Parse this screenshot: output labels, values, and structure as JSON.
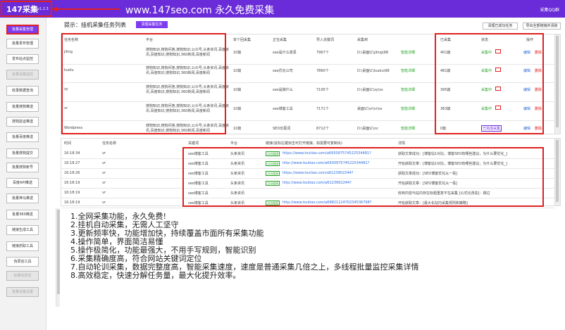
{
  "header": {
    "app_title": "147采集",
    "version": "v1.2.3",
    "promo": "www.147seo.com   永久免费采集",
    "qq_link": "采集QQ群"
  },
  "sidebar": {
    "items": [
      {
        "label": "批量采集管理",
        "state": "active"
      },
      {
        "label": "批量发布管理",
        "state": "normal"
      },
      {
        "label": "发布站点监控",
        "state": "normal"
      },
      {
        "label": "批量采集监控",
        "state": "disabled"
      },
      {
        "label": "收录数据查询",
        "state": "normal"
      },
      {
        "label": "批量搜狗推送",
        "state": "normal"
      },
      {
        "label": "搜狗验证推送",
        "state": "normal"
      },
      {
        "label": "批量百度推送",
        "state": "normal"
      },
      {
        "label": "批量搜狗提交",
        "state": "normal"
      },
      {
        "label": "批量搜狗帐号",
        "state": "normal"
      },
      {
        "label": "百度API推送",
        "state": "normal"
      },
      {
        "label": "批量神马推送",
        "state": "normal"
      },
      {
        "label": "批量360推送",
        "state": "normal"
      },
      {
        "label": "链接生成工具",
        "state": "normal"
      },
      {
        "label": "链接抓取工具",
        "state": "normal"
      },
      {
        "label": "伪原创工具",
        "state": "normal"
      },
      {
        "label": "批量伪原创",
        "state": "disabled"
      },
      {
        "label": "批量采集设置",
        "state": "disabled"
      }
    ]
  },
  "toolbar": {
    "tip": "提示：挂机采集任务列表",
    "clear_button": "清理采集任务",
    "import_button": "清理已成功任务",
    "export_button": "导出全部链接并清除"
  },
  "task_table": {
    "headers": [
      "任务名称",
      "平台",
      "单个回采集",
      "正在采集",
      "导入关键词",
      "采集到",
      "已采集",
      "状态",
      "操作"
    ],
    "rows": [
      {
        "name": "jiling",
        "platform": "搜狗知识,搜狗问答,搜狗知识,公众号,头条资讯,百度资讯,百度知识,搜狗知识,360新闻,百度新闻",
        "single": "10篇",
        "current": "seo是什么意思",
        "keywords": "7967个",
        "path": "D:\\桌面\\C\\jiling\\98",
        "status_link": "智能详细",
        "collected": "401篇",
        "state": "采集中",
        "edit": "编辑",
        "del": "删除"
      },
      {
        "name": "kuolu",
        "platform": "搜狗知识,搜狗问答,搜狗知识,公众号,头条资讯,百度资讯,百度知识,搜狗知识,360新闻,百度新闻",
        "single": "10篇",
        "current": "seo优化公司",
        "keywords": "7860个",
        "path": "D:\\桌面\\C\\kuolu\\98",
        "status_link": "智能详细",
        "collected": "481篇",
        "state": "采集中",
        "edit": "编辑",
        "del": "删除"
      },
      {
        "name": "zy",
        "platform": "搜狗知识,搜狗问答,搜狗知识,公众号,头条资讯,百度资讯,百度知识,搜狗知识,360新闻,百度新闻",
        "single": "10篇",
        "current": "seo是做什么",
        "keywords": "7195个",
        "path": "D:\\桌面\\C\\zy\\ss",
        "status_link": "智能详细",
        "collected": "395篇",
        "state": "采集中",
        "edit": "编辑",
        "del": "删除"
      },
      {
        "name": "vr",
        "platform": "搜狗知识,搜狗问答,搜狗知识,公众号,头条资讯,百度资讯,百度知识,搜狗知识,360新闻,百度新闻",
        "single": "10篇",
        "current": "seo博客工具",
        "keywords": "7171个",
        "path": "桌面\\C\\vr\\vr\\ss",
        "status_link": "智能详细",
        "collected": "363篇",
        "state": "采集中",
        "edit": "编辑",
        "del": "删除"
      },
      {
        "name": "Wordpress",
        "platform": "搜狗知识,搜狗问答,搜狗知识,公众号,头条资讯,百度资讯,百度知识,搜狗知识,360新闻,百度新闻",
        "single": "10篇",
        "current": "SEO长尾词",
        "keywords": "8712个",
        "path": "D:\\桌面\\C\\nc",
        "status_link": "智能详细",
        "collected": "0篇",
        "state": "已完成采集",
        "edit": "编辑",
        "del": "删除"
      }
    ]
  },
  "log_table": {
    "headers": [
      "时间",
      "任务名称",
      "关键词",
      "平台",
      "链接(鼠标左键双击可打开链接，如需要可复制出)",
      "详情"
    ],
    "rows": [
      {
        "time": "16:18:34",
        "task": "vr",
        "keyword": "seo博客工具",
        "platform": "头条资讯",
        "tag": "点击链接",
        "url": "https://www.toutiao.com/a693097574522534481?",
        "detail": "获取文章成功：[博客站1对比，博客SEO有哪些建议，为什么要优化_]"
      },
      {
        "time": "16:18:27",
        "task": "vr",
        "keyword": "seo博客工具",
        "platform": "头条资讯",
        "tag": "点击链接",
        "url": "http://www.toutiao.com/a693097574522534481?",
        "detail": "开始获取文章：[博客站1对比，博客SEO有哪些建议，为什么要优化_]"
      },
      {
        "time": "16:18:26",
        "task": "vr",
        "keyword": "seo博客工具",
        "platform": "头条资讯",
        "tag": "点击链接",
        "url": "https://www.toutiao.com/a6123902244?",
        "detail": "获取文章成功：[SEO博客优化从一看]"
      },
      {
        "time": "16:18:19",
        "task": "vr",
        "keyword": "seo博客工具",
        "platform": "头条资讯",
        "tag": "点击链接",
        "url": "http://www.toutiao.com/a6123902244?",
        "detail": "开始获取文章：[SEO博客优化从一看]"
      },
      {
        "time": "16:18:19",
        "task": "vr",
        "keyword": "seo博客工具",
        "platform": "头条资讯",
        "tag": "",
        "url": "",
        "detail": "收到内容与站内存在标题重复不在采集 [公式化改造]：跳过"
      },
      {
        "time": "16:18:19",
        "task": "vr",
        "keyword": "seo博客工具",
        "platform": "头条资讯",
        "tag": "点击链接",
        "url": "http://www.toutiao.com/a6982112470234536798?",
        "detail": "开始获取文章：[最大化站内采集规则和策略]"
      }
    ]
  },
  "features": [
    "1.全网采集功能，永久免费!",
    "2.挂机自动采集，无需人工坚守",
    "3.更新频率快，功能增加快，持续覆盖市面所有采集功能",
    "4.操作简单，界面简洁易懂",
    "5.操作极简化，功能最强大，不用手写规则，智能识别",
    "6.采集精确度高，符合网站关键词定位",
    "7.自动轮训采集，数据完整度高，智能采集速度，速度是普通采集几倍之上，多线程批量监控采集详情",
    "8.高效稳定，快速分解任务量，最大化提升效率。"
  ],
  "colors": {
    "brand": "#6a2bd9",
    "highlight": "#e02020",
    "success": "#2aa52a"
  }
}
